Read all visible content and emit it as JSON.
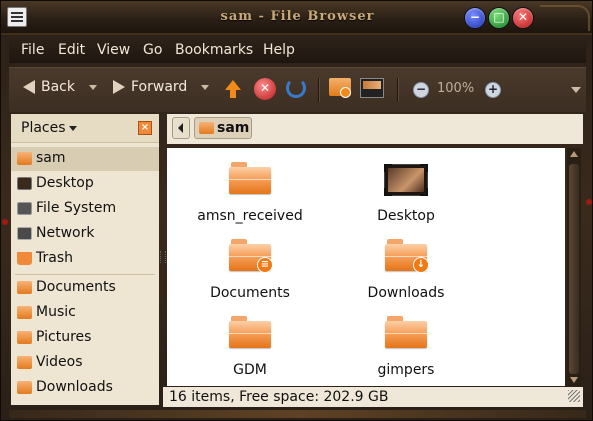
{
  "window": {
    "title": "sam - File Browser"
  },
  "menubar": {
    "items": [
      "File",
      "Edit",
      "View",
      "Go",
      "Bookmarks",
      "Help"
    ]
  },
  "toolbar": {
    "back": "Back",
    "forward": "Forward",
    "zoom": "100%"
  },
  "sidebar": {
    "title": "Places",
    "items": [
      {
        "label": "sam",
        "icon": "home-folder-icon",
        "selected": true
      },
      {
        "label": "Desktop",
        "icon": "desktop-icon"
      },
      {
        "label": "File System",
        "icon": "drive-icon"
      },
      {
        "label": "Network",
        "icon": "network-icon"
      },
      {
        "label": "Trash",
        "icon": "trash-icon"
      },
      {
        "label": "Documents",
        "icon": "folder-icon"
      },
      {
        "label": "Music",
        "icon": "folder-icon"
      },
      {
        "label": "Pictures",
        "icon": "folder-icon"
      },
      {
        "label": "Videos",
        "icon": "folder-icon"
      },
      {
        "label": "Downloads",
        "icon": "folder-icon"
      }
    ]
  },
  "pathbar": {
    "current": "sam"
  },
  "files": [
    {
      "name": "amsn_received",
      "icon": "folder-icon"
    },
    {
      "name": "Desktop",
      "icon": "desktop-icon"
    },
    {
      "name": "Documents",
      "icon": "documents-folder-icon"
    },
    {
      "name": "Downloads",
      "icon": "downloads-folder-icon"
    },
    {
      "name": "GDM",
      "icon": "folder-icon"
    },
    {
      "name": "gimpers",
      "icon": "folder-icon"
    }
  ],
  "statusbar": {
    "text": "16 items, Free space: 202.9 GB"
  },
  "colors": {
    "accent": "#f08a1a",
    "sidebar_bg": "#eee6d2",
    "frame": "#2a2018"
  }
}
